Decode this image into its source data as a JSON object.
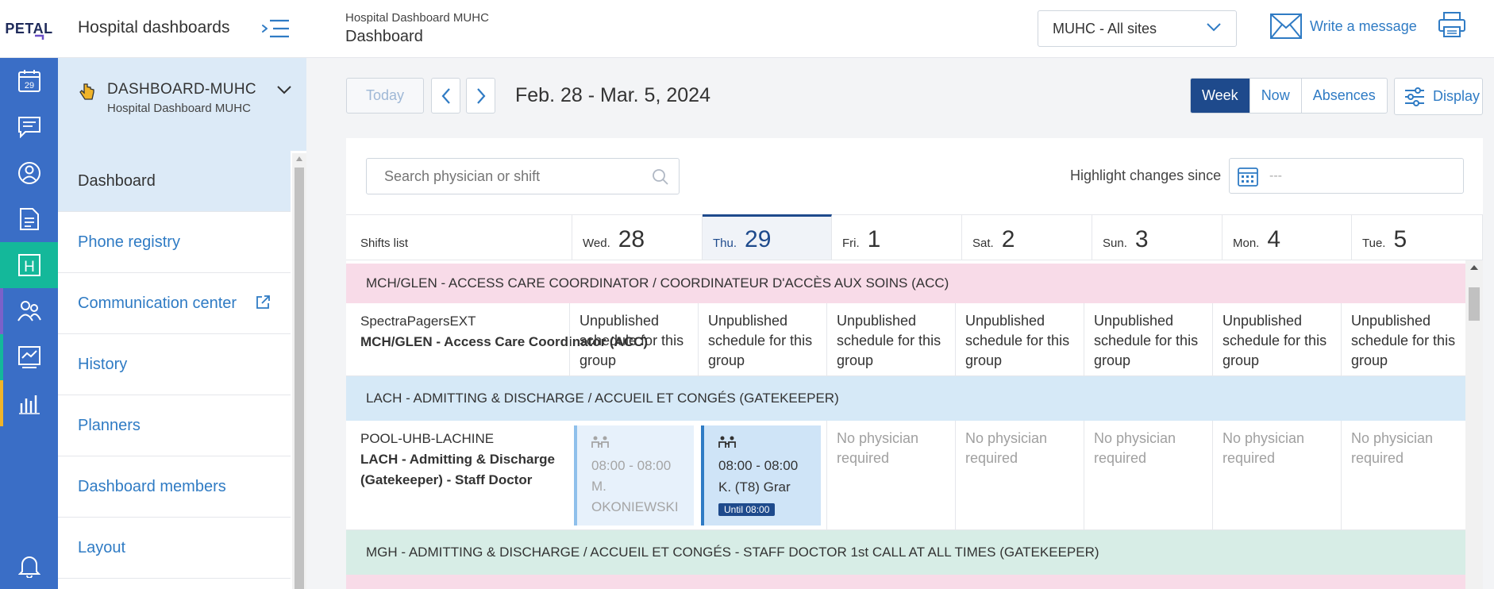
{
  "header": {
    "logo": "PETAL",
    "app_title": "Hospital dashboards",
    "breadcrumb_small": "Hospital Dashboard MUHC",
    "breadcrumb_title": "Dashboard",
    "site_select": "MUHC - All sites",
    "write_message": "Write a message"
  },
  "rail": {
    "calendar_day": "29",
    "h_label": "H",
    "accents": [
      "#7b61c9",
      "#14b89a",
      "#f0b429",
      "#3a6ec6"
    ]
  },
  "sidebar": {
    "dashboard_name": "DASHBOARD-MUHC",
    "dashboard_sub": "Hospital Dashboard MUHC",
    "items": [
      {
        "label": "Dashboard"
      },
      {
        "label": "Phone registry"
      },
      {
        "label": "Communication center"
      },
      {
        "label": "History"
      },
      {
        "label": "Planners"
      },
      {
        "label": "Dashboard members"
      },
      {
        "label": "Layout"
      }
    ]
  },
  "toolbar": {
    "today": "Today",
    "date_range": "Feb. 28 - Mar. 5, 2024",
    "views": [
      "Week",
      "Now",
      "Absences"
    ],
    "display": "Display"
  },
  "schedule": {
    "search_placeholder": "Search physician or shift",
    "highlight_label": "Highlight changes since",
    "highlight_value": "---",
    "shifts_list": "Shifts list",
    "days": [
      {
        "name": "Wed.",
        "num": "28"
      },
      {
        "name": "Thu.",
        "num": "29"
      },
      {
        "name": "Fri.",
        "num": "1"
      },
      {
        "name": "Sat.",
        "num": "2"
      },
      {
        "name": "Sun.",
        "num": "3"
      },
      {
        "name": "Mon.",
        "num": "4"
      },
      {
        "name": "Tue.",
        "num": "5"
      }
    ],
    "groups": [
      {
        "title": "MCH/GLEN - ACCESS CARE COORDINATOR / COORDINATEUR D'ACCÈS AUX SOINS (ACC)",
        "color": "#f8dbe8",
        "pager": "SpectraPagersEXT",
        "shift": "MCH/GLEN - Access Care Coordinator (ACC)",
        "cell_text": "Unpublished schedule for this group"
      },
      {
        "title": "LACH - ADMITTING & DISCHARGE / ACCUEIL ET CONGÉS (GATEKEEPER)",
        "color": "#d6e9f7",
        "pager": "POOL-UHB-LACHINE",
        "shift": "LACH - Admitting & Discharge (Gatekeeper) - Staff Doctor",
        "wed": {
          "time": "08:00 - 08:00",
          "doc": "M. OKONIEWSKI"
        },
        "thu": {
          "time": "08:00 - 08:00",
          "doc": "K. (T8) Grar",
          "badge": "Until 08:00"
        },
        "cell_text": "No physician required"
      },
      {
        "title": "MGH - ADMITTING & DISCHARGE / ACCUEIL ET CONGÉS - STAFF DOCTOR 1st CALL AT ALL TIMES (GATEKEEPER)",
        "color": "#d7ede6"
      }
    ]
  }
}
